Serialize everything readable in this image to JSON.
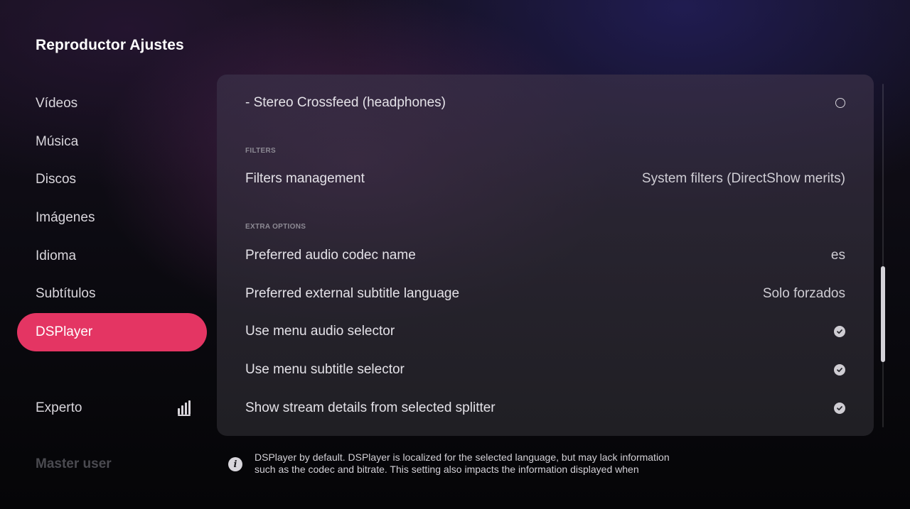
{
  "header": {
    "title": "Reproductor Ajustes"
  },
  "sidebar": {
    "items": [
      {
        "label": "Vídeos"
      },
      {
        "label": "Música"
      },
      {
        "label": "Discos"
      },
      {
        "label": "Imágenes"
      },
      {
        "label": "Idioma"
      },
      {
        "label": "Subtítulos"
      },
      {
        "label": "DSPlayer",
        "active": true
      }
    ],
    "expert_label": "Experto",
    "expert_icon": "settings-level-icon",
    "master_user_label": "Master user"
  },
  "panel": {
    "rows": {
      "crossfeed": {
        "label": "- Stereo Crossfeed (headphones)",
        "control": "radio",
        "checked": false
      },
      "filters_management": {
        "label": "Filters management",
        "value": "System filters (DirectShow merits)"
      },
      "audio_codec": {
        "label": "Preferred audio codec name",
        "value": "es"
      },
      "subtitle_language": {
        "label": "Preferred external subtitle language",
        "value": "Solo forzados"
      },
      "menu_audio_selector": {
        "label": "Use menu audio selector",
        "control": "check",
        "checked": true
      },
      "menu_subtitle_selector": {
        "label": "Use menu subtitle selector",
        "control": "check",
        "checked": true
      },
      "stream_details": {
        "label": "Show stream details from selected splitter",
        "control": "check",
        "checked": true
      }
    },
    "sections": {
      "filters": "FILTERS",
      "extra_options": "EXTRA OPTIONS"
    }
  },
  "footer": {
    "info_icon": "info-icon",
    "lines": [
      "DSPlayer by default. DSPlayer is localized for the selected language, but may lack information",
      "such as the codec and bitrate. This setting also impacts the information displayed when"
    ]
  },
  "colors": {
    "accent": "#e43563",
    "panel_text": "#e4e2e8",
    "muted": "#4a4a50"
  }
}
